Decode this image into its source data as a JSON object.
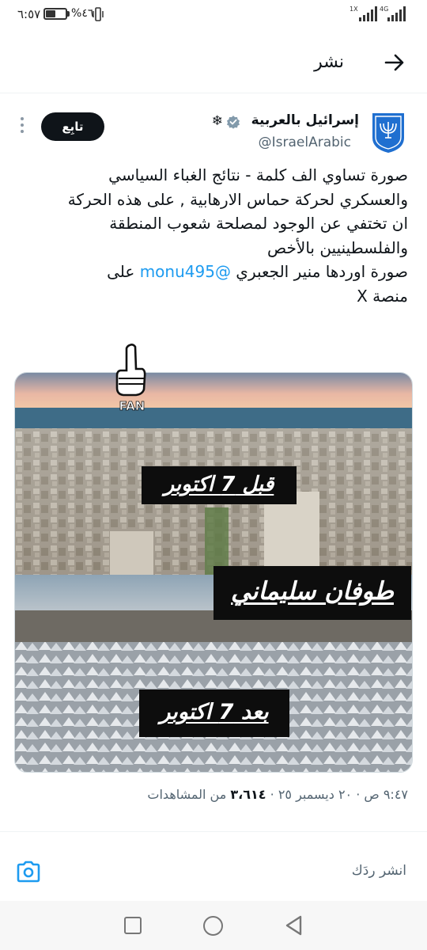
{
  "status_bar": {
    "time": "٦:٥٧",
    "battery_percent": "%٤٦",
    "battery_level": 0.46,
    "network_1": "1X",
    "network_2": "4G"
  },
  "header": {
    "title": "نشر",
    "back_icon": "arrow-right-icon"
  },
  "tweet": {
    "author_name": "إسرائيل بالعربية",
    "verified_icon": "verified-badge-icon",
    "snowflake": "❄",
    "handle": "@IsraelArabic",
    "follow_label": "تابِع",
    "body_lines": [
      "صورة تساوي الف كلمة - نتائج الغباء السياسي",
      "والعسكري لحركة حماس الارهابية , على هذه الحركة",
      "ان تختفي عن الوجود لمصلحة شعوب المنطقة",
      "والفلسطينيين بالأخص"
    ],
    "credit_prefix": "صورة اوردها منير الجعبري ",
    "credit_mention": "@monu495",
    "credit_suffix": " على",
    "credit_line2": "منصة X",
    "sticker_text": "FAN",
    "media": {
      "caption_before": "قبل 7 اكتوبر",
      "caption_title": "طوفان سليماني",
      "caption_after": "بعد 7 اكتوبر"
    },
    "time": "٩:٤٧ ص",
    "date": "٢٠ ديسمبر ٢٥",
    "views_count": "٣،٦١٤",
    "views_label": "من المشاهدات"
  },
  "reply": {
    "placeholder": "انشر ردَك"
  },
  "colors": {
    "accent": "#1d9bf0",
    "text": "#0f1419",
    "secondary": "#536471",
    "button_bg": "#0f1419"
  }
}
